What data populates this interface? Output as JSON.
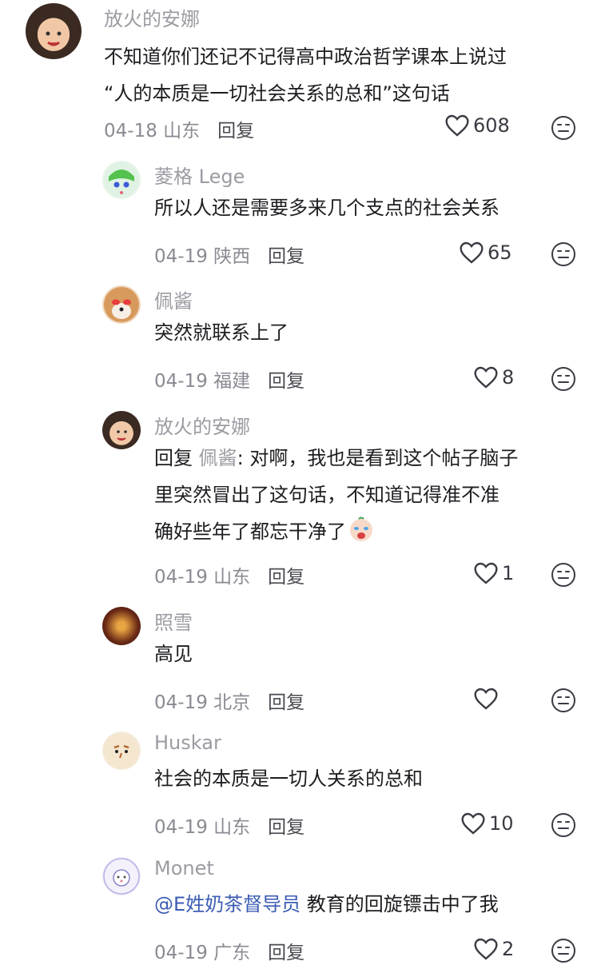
{
  "comments": [
    {
      "author": "放火的安娜",
      "lines": [
        "不知道你们还记不记得高中政治哲学课本上说过",
        "“人的本质是一切社会关系的总和”这句话"
      ],
      "date": "04-18",
      "location": "山东",
      "reply_label": "回复",
      "likes": "608"
    },
    {
      "author": "菱格 Lege",
      "lines": [
        "所以人还是需要多来几个支点的社会关系"
      ],
      "date": "04-19",
      "location": "陕西",
      "reply_label": "回复",
      "likes": "65"
    },
    {
      "author": "佩酱",
      "lines": [
        "突然就联系上了"
      ],
      "date": "04-19",
      "location": "福建",
      "reply_label": "回复",
      "likes": "8"
    },
    {
      "author": "放火的安娜",
      "reply_prefix": "回复 ",
      "reply_to": "佩酱",
      "reply_colon": ": ",
      "lines": [
        "对啊，我也是看到这个帖子脑子",
        "里突然冒出了这句话，不知道记得准不准",
        "确好些年了都忘干净了"
      ],
      "date": "04-19",
      "location": "山东",
      "reply_label": "回复",
      "likes": "1"
    },
    {
      "author": "照雪",
      "lines": [
        "高见"
      ],
      "date": "04-19",
      "location": "北京",
      "reply_label": "回复",
      "likes": ""
    },
    {
      "author": "Huskar",
      "lines": [
        "社会的本质是一切人关系的总和"
      ],
      "date": "04-19",
      "location": "山东",
      "reply_label": "回复",
      "likes": "10"
    },
    {
      "author": "Monet",
      "mention": "@E姓奶茶督导员",
      "lines": [
        " 教育的回旋镖击中了我"
      ],
      "date": "04-19",
      "location": "广东",
      "reply_label": "回复",
      "likes": "2"
    }
  ],
  "colors": {
    "author": "#9b9ba3",
    "text": "#1d1d21",
    "meta": "#8a8a93",
    "mention": "#3c5cb4"
  },
  "icons": {
    "like": "heart-outline-icon",
    "dislike": "neutral-face-icon"
  }
}
